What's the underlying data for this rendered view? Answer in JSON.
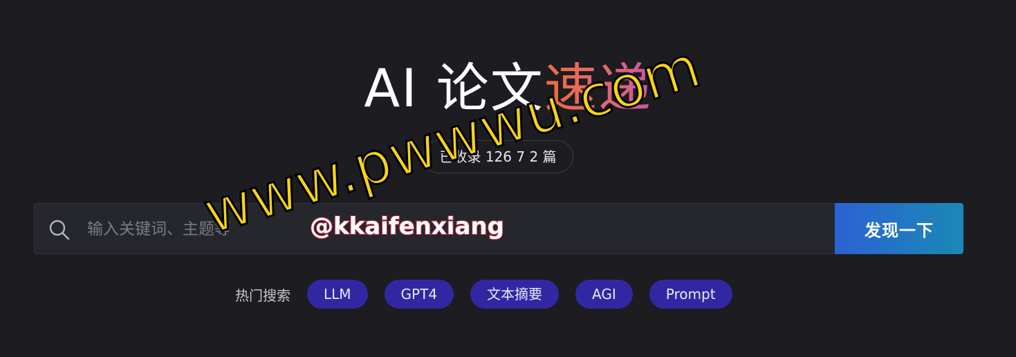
{
  "header": {
    "title_prefix": "AI 论文",
    "title_accent": "速递",
    "count_text": "已收录 126 7 2 篇"
  },
  "search": {
    "placeholder": "输入关键词、主题等",
    "value": "",
    "button_label": "发现一下"
  },
  "hot": {
    "label": "热门搜索",
    "tags": [
      "LLM",
      "GPT4",
      "文本摘要",
      "AGI",
      "Prompt"
    ]
  },
  "overlays": {
    "watermark": "www.pwwwu.com",
    "handle": "@kkaifenxiang"
  },
  "colors": {
    "background": "#1c1c21",
    "accent_start": "#f06a3b",
    "accent_end": "#c95aa0",
    "button_start": "#2b62d3",
    "button_end": "#1a89b5",
    "tag_bg": "#3227a3"
  },
  "icons": {
    "search": "search-icon"
  }
}
